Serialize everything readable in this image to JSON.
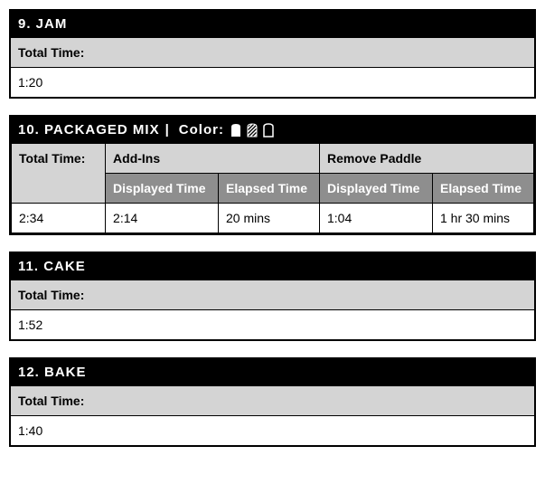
{
  "sections": {
    "jam": {
      "title": "9. JAM",
      "total_time_label": "Total Time:",
      "total_time_value": "1:20"
    },
    "packaged_mix": {
      "title": "10. PACKAGED MIX",
      "separator": "|",
      "color_label": "Color:",
      "table": {
        "total_time_label": "Total Time:",
        "addins_label": "Add-Ins",
        "remove_paddle_label": "Remove Paddle",
        "displayed_time_label_a": "Displayed Time",
        "elapsed_time_label_a": "Elapsed Time",
        "displayed_time_label_b": "Displayed Time",
        "elapsed_time_label_b": "Elapsed Time",
        "total_time_value": "2:34",
        "addins_displayed": "2:14",
        "addins_elapsed": "20 mins",
        "remove_displayed": "1:04",
        "remove_elapsed": "1 hr 30 mins"
      }
    },
    "cake": {
      "title": "11. CAKE",
      "total_time_label": "Total Time:",
      "total_time_value": "1:52"
    },
    "bake": {
      "title": "12. BAKE",
      "total_time_label": "Total Time:",
      "total_time_value": "1:40"
    }
  }
}
